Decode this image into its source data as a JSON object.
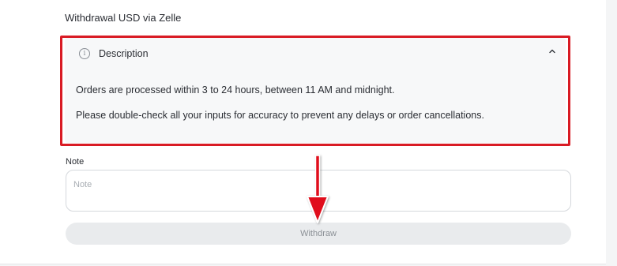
{
  "page": {
    "title": "Withdrawal USD via Zelle"
  },
  "description": {
    "title": "Description",
    "lines": [
      "Orders are processed within 3 to 24 hours, between 11 AM and midnight.",
      "Please double-check all your inputs for accuracy to prevent any delays or order cancellations."
    ],
    "info_icon": "info-circle-icon",
    "toggle_icon": "chevron-up-icon"
  },
  "note": {
    "label": "Note",
    "placeholder": "Note",
    "value": ""
  },
  "actions": {
    "withdraw_label": "Withdraw"
  },
  "colors": {
    "highlight": "#d91b24",
    "button_bg": "#e9ebed",
    "button_text": "#8b9096"
  }
}
